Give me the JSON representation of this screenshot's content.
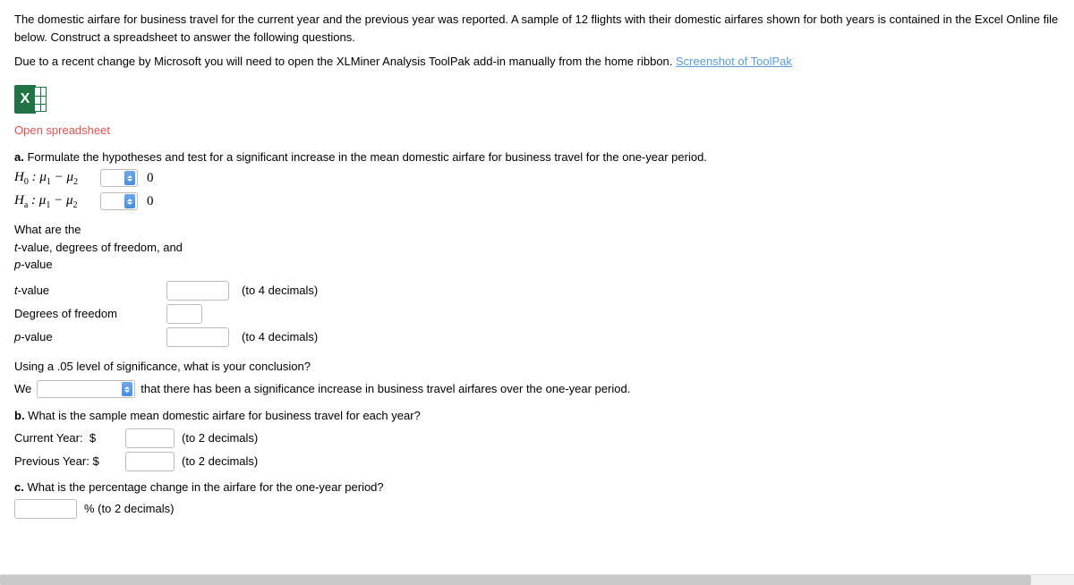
{
  "intro": {
    "p1": "The domestic airfare for business travel for the current year and the previous year was reported. A sample of 12 flights with their domestic airfares shown for both years is contained in the Excel Online file below. Construct a spreadsheet to answer the following questions.",
    "p2_prefix": "Due to a recent change by Microsoft you will need to open the XLMiner Analysis ToolPak add-in manually from the home ribbon. ",
    "p2_link": "Screenshot of ToolPak"
  },
  "open_link": "Open spreadsheet",
  "partA": {
    "label": "a.",
    "text": " Formulate the hypotheses and test for a significant increase in the mean domestic airfare for business travel for the one-year period.",
    "h0_label": "H",
    "h0_sub": "0",
    "h0_rest": " : μ",
    "mu1_sub": "1",
    "minus": " − μ",
    "mu2_sub": "2",
    "ha_sub": "a",
    "zero": "0",
    "q2": "What are the",
    "q2b": "t-value, degrees of freedom, and",
    "q2c": "p-value",
    "tvalue_label": "t-value",
    "df_label": "Degrees of freedom",
    "pvalue_label": "p-value",
    "hint4": "(to 4 decimals)",
    "conclusion_q": "Using a .05 level of significance, what is your conclusion?",
    "we": "We",
    "conclusion_text": " that there has been a significance increase in business travel airfares over the one-year period."
  },
  "partB": {
    "label": "b.",
    "text": " What is the sample mean domestic airfare for business travel for each year?",
    "cy_label": "Current Year:",
    "py_label": "Previous Year:",
    "dollar": "$",
    "hint2": "(to 2 decimals)"
  },
  "partC": {
    "label": "c.",
    "text": " What is the percentage change in the airfare for the one-year period?",
    "pct": "% (to 2 decimals)"
  }
}
